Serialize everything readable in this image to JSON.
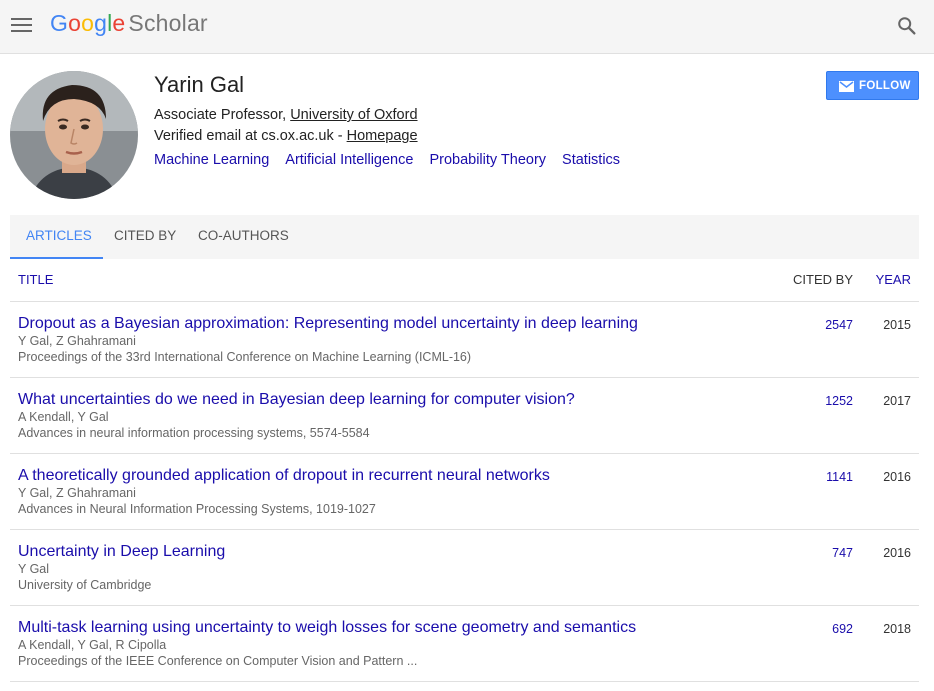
{
  "header": {
    "logo_letters": [
      "G",
      "o",
      "o",
      "g",
      "l",
      "e"
    ],
    "logo_suffix": "Scholar",
    "menu_icon": "hamburger-menu-icon",
    "search_icon": "search-icon"
  },
  "profile": {
    "name": "Yarin Gal",
    "affiliation_prefix": "Associate Professor, ",
    "affiliation_link": "University of Oxford",
    "email_prefix": "Verified email at cs.ox.ac.uk - ",
    "homepage_link": "Homepage",
    "interests": [
      "Machine Learning",
      "Artificial Intelligence",
      "Probability Theory",
      "Statistics"
    ],
    "follow_label": "FOLLOW"
  },
  "tabs": [
    {
      "label": "ARTICLES",
      "active": true
    },
    {
      "label": "CITED BY",
      "active": false
    },
    {
      "label": "CO-AUTHORS",
      "active": false
    }
  ],
  "table": {
    "col_title": "TITLE",
    "col_cited": "CITED BY",
    "col_year": "YEAR",
    "rows": [
      {
        "title": "Dropout as a Bayesian approximation: Representing model uncertainty in deep learning",
        "authors": "Y Gal, Z Ghahramani",
        "venue": "Proceedings of the 33rd International Conference on Machine Learning (ICML-16)",
        "cited": "2547",
        "year": "2015"
      },
      {
        "title": "What uncertainties do we need in Bayesian deep learning for computer vision?",
        "authors": "A Kendall, Y Gal",
        "venue": "Advances in neural information processing systems, 5574-5584",
        "cited": "1252",
        "year": "2017"
      },
      {
        "title": "A theoretically grounded application of dropout in recurrent neural networks",
        "authors": "Y Gal, Z Ghahramani",
        "venue": "Advances in Neural Information Processing Systems, 1019-1027",
        "cited": "1141",
        "year": "2016"
      },
      {
        "title": "Uncertainty in Deep Learning",
        "authors": "Y Gal",
        "venue": "University of Cambridge",
        "cited": "747",
        "year": "2016"
      },
      {
        "title": "Multi-task learning using uncertainty to weigh losses for scene geometry and semantics",
        "authors": "A Kendall, Y Gal, R Cipolla",
        "venue": "Proceedings of the IEEE Conference on Computer Vision and Pattern ...",
        "cited": "692",
        "year": "2018"
      }
    ]
  },
  "colors": {
    "link": "#1a0dab",
    "accent": "#4285f4",
    "follow_button": "#4d90fe",
    "topbar": "#f5f5f5"
  }
}
